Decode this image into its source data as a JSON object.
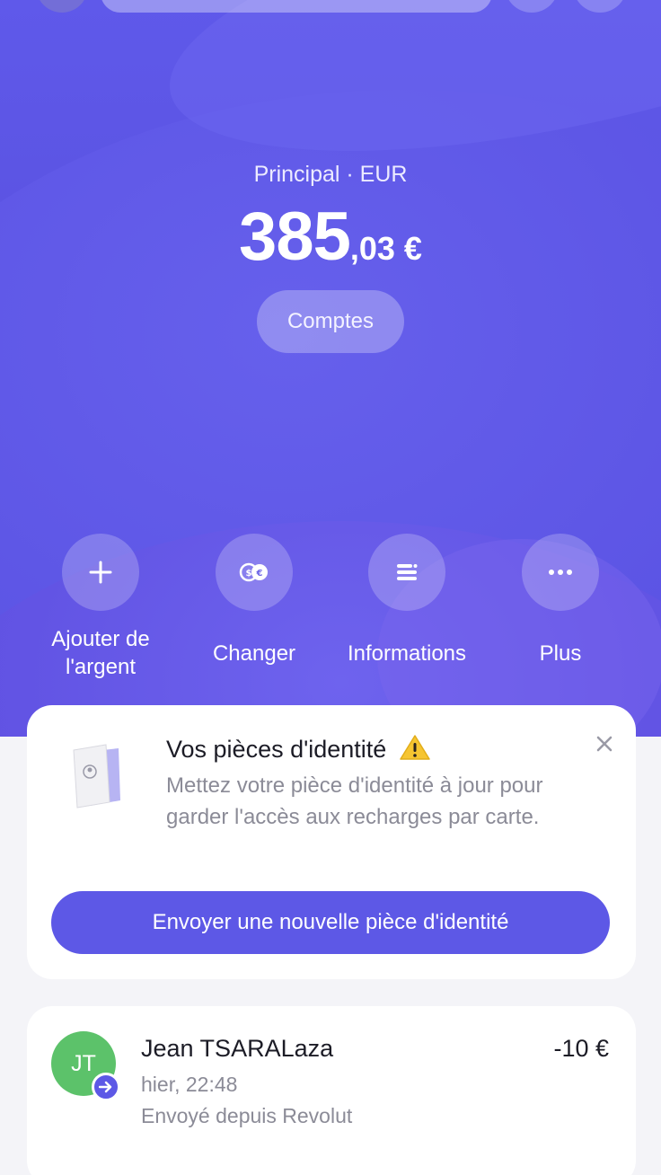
{
  "account": {
    "label": "Principal · EUR",
    "balance_int": "385",
    "balance_dec": ",03 €"
  },
  "accounts_button": "Comptes",
  "actions": [
    {
      "label": "Ajouter de l'argent",
      "icon": "plus-icon"
    },
    {
      "label": "Changer",
      "icon": "exchange-icon"
    },
    {
      "label": "Informations",
      "icon": "details-icon"
    },
    {
      "label": "Plus",
      "icon": "more-icon"
    }
  ],
  "id_notice": {
    "title": "Vos pièces d'identité",
    "description": "Mettez votre pièce d'identité à jour pour garder l'accès aux recharges par carte.",
    "button": "Envoyer une nouvelle pièce d'identité"
  },
  "transaction": {
    "initials": "JT",
    "name": "Jean TSARALaza",
    "amount": "-10 €",
    "time": "hier, 22:48",
    "description": "Envoyé depuis Revolut",
    "avatar_color": "#5cc26a"
  },
  "colors": {
    "accent": "#5d58e6",
    "hero": "#5a52e0"
  }
}
